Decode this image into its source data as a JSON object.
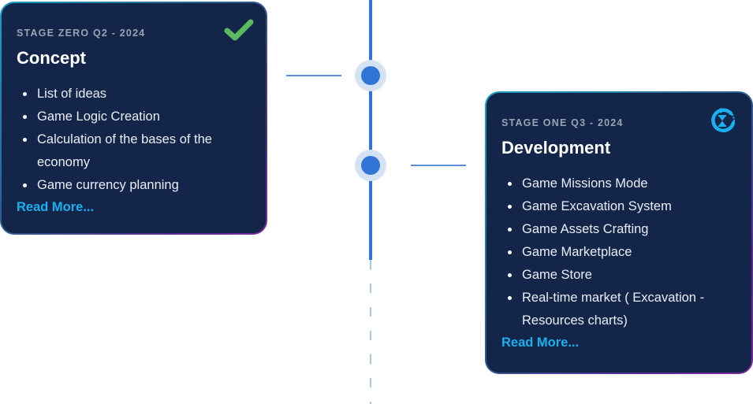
{
  "timeline": {
    "colors": {
      "spine": "#2f74d6",
      "node_halo": "#d4e2f4",
      "connector": "#5d8fd8",
      "dashed": "#aacbe6",
      "card_bg": "#13264a",
      "border_start": "#1aa0c4",
      "border_end": "#7a2a9b",
      "done": "#5cb85c",
      "in_progress": "#1ab0ef",
      "link": "#1ab0ef"
    },
    "stages": [
      {
        "stage_label": "STAGE ZERO Q2 - 2024",
        "title": "Concept",
        "status": "completed",
        "status_icon": "checkmark-icon",
        "items": [
          "List of ideas",
          "Game Logic Creation",
          "Calculation of the bases of the economy",
          "Game currency planning"
        ],
        "read_more": "Read More..."
      },
      {
        "stage_label": "STAGE ONE Q3 - 2024",
        "title": "Development",
        "status": "in-progress",
        "status_icon": "hourglass-refresh-icon",
        "items": [
          "Game Missions Mode",
          "Game Excavation System",
          "Game Assets Crafting",
          "Game Marketplace",
          "Game Store",
          "Real-time market ( Excavation - Resources charts)"
        ],
        "read_more": "Read More..."
      }
    ]
  }
}
